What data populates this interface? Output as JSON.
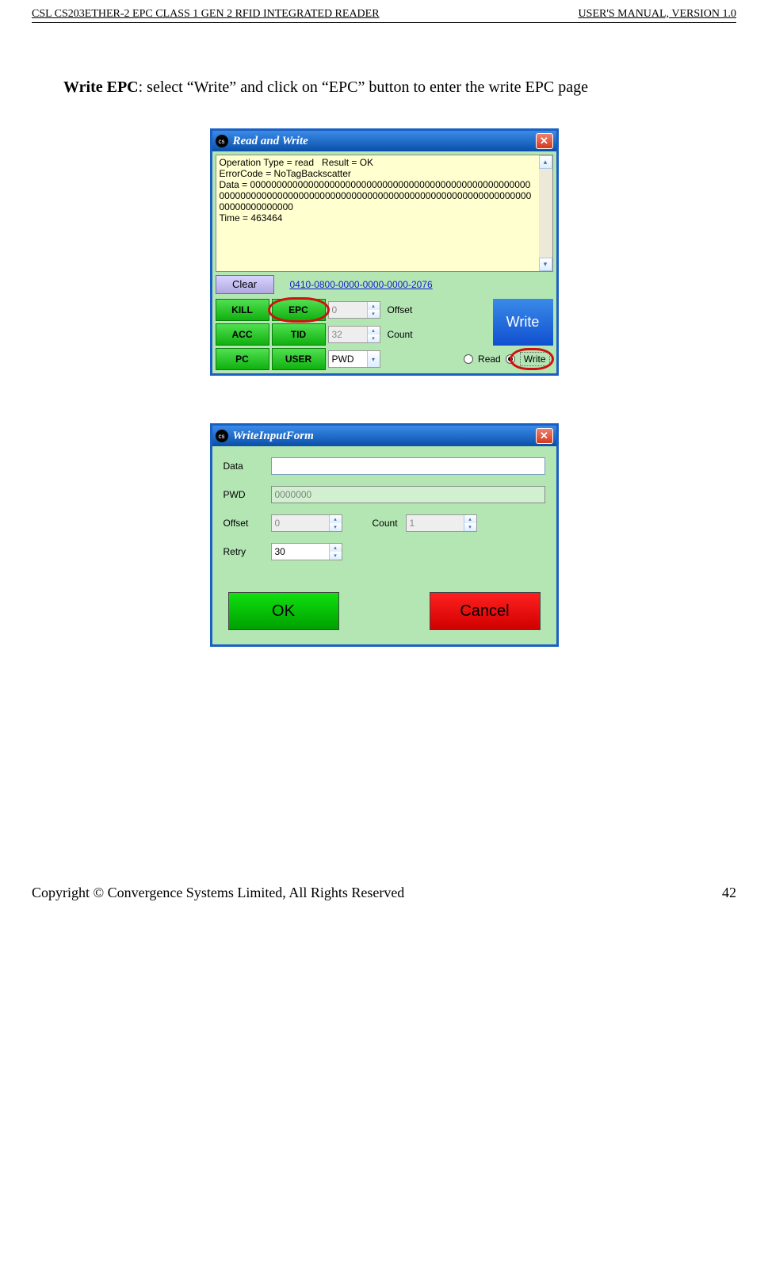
{
  "header": {
    "left": "CSL CS203ETHER-2 EPC CLASS 1 GEN 2 RFID INTEGRATED READER",
    "right": "USER'S  MANUAL,  VERSION  1.0"
  },
  "body_text": {
    "strong": "Write EPC",
    "rest": ": select “Write” and click on “EPC” button to enter the write EPC page"
  },
  "win1": {
    "title": "Read and Write",
    "log": "Operation Type = read   Result = OK\nErrorCode = NoTagBackscatter\nData = 000000000000000000000000000000000000000000000000000000000000000000000000000000000000000000000000000000000000000000000000000000\nTime = 463464",
    "clear": "Clear",
    "epc_link": "0410-0800-0000-0000-0000-2076",
    "buttons": {
      "kill": "KILL",
      "epc": "EPC",
      "acc": "ACC",
      "tid": "TID",
      "pc": "PC",
      "user": "USER"
    },
    "offset_value": "0",
    "offset_label": "Offset",
    "count_value": "32",
    "count_label": "Count",
    "pwd_value": "PWD",
    "write_btn": "Write",
    "radio_read": "Read",
    "radio_write": "Write"
  },
  "win2": {
    "title": "WriteInputForm",
    "labels": {
      "data": "Data",
      "pwd": "PWD",
      "offset": "Offset",
      "count": "Count",
      "retry": "Retry"
    },
    "values": {
      "data": "",
      "pwd": "0000000",
      "offset": "0",
      "count": "1",
      "retry": "30"
    },
    "ok": "OK",
    "cancel": "Cancel"
  },
  "footer": {
    "left": "Copyright © Convergence Systems Limited, All Rights Reserved",
    "right": "42"
  }
}
